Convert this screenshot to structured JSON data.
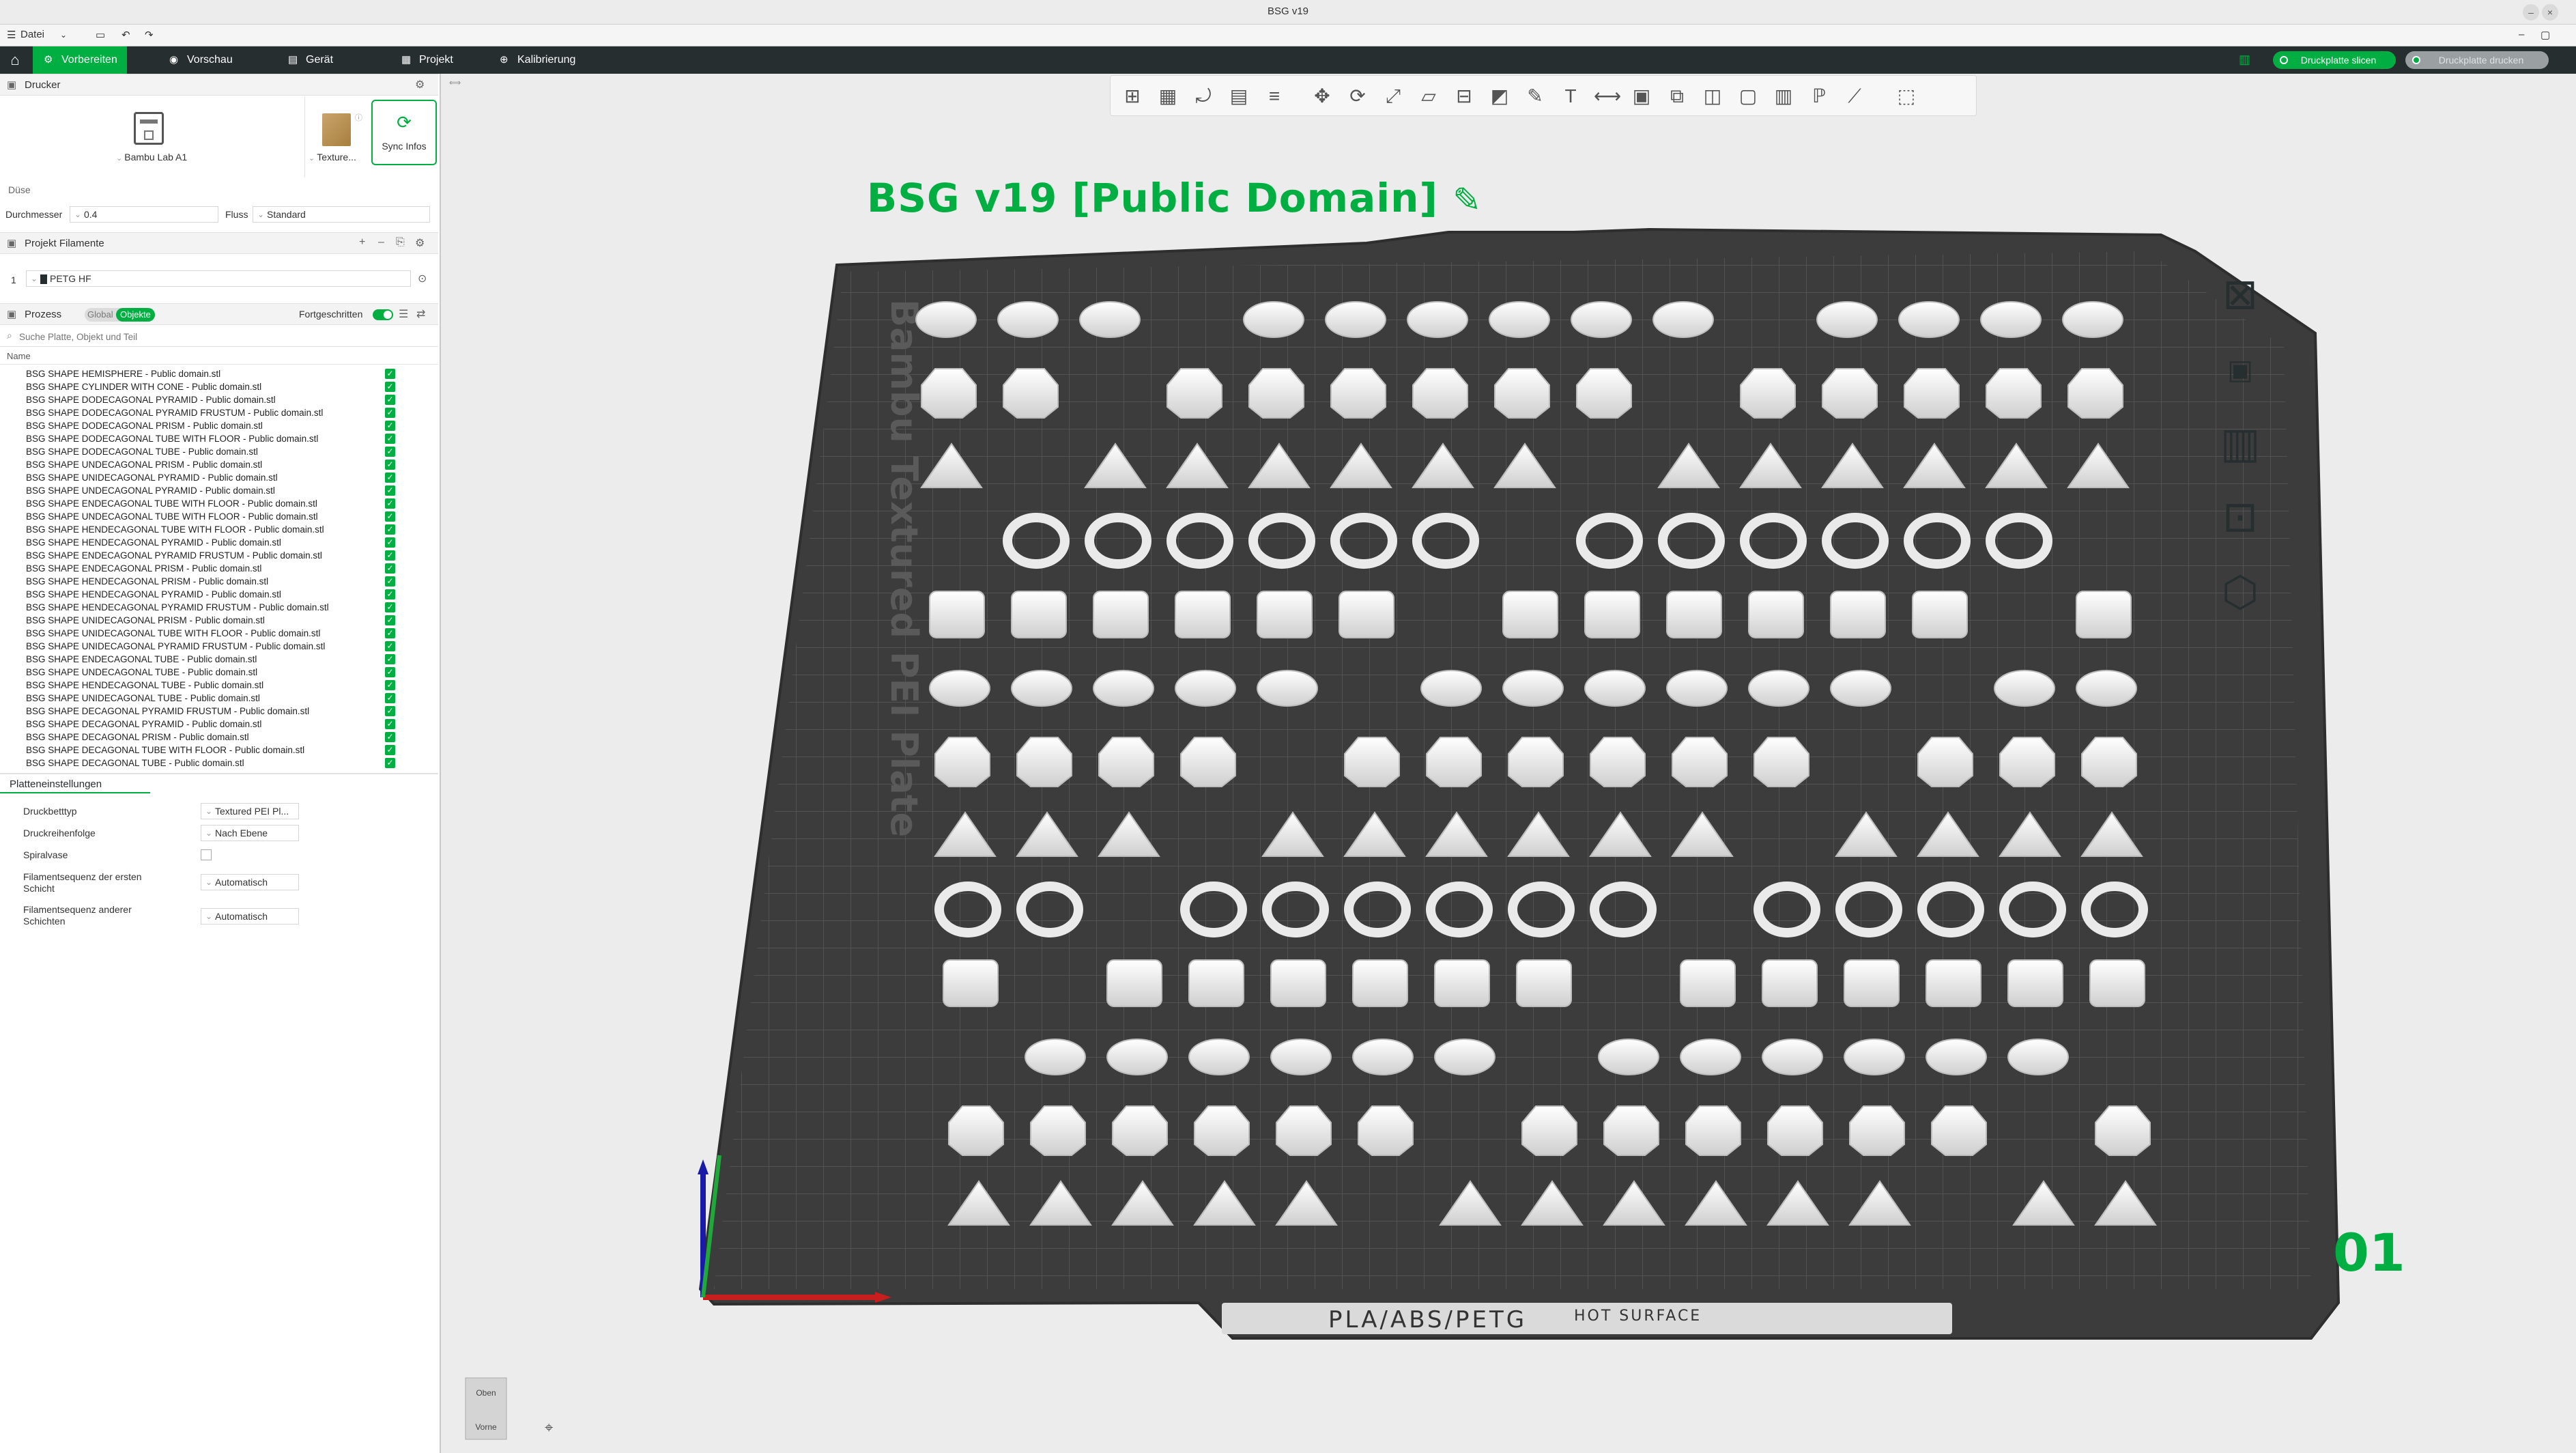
{
  "window": {
    "title": "BSG v19"
  },
  "menu": {
    "file": "Datei"
  },
  "tabs": [
    {
      "label": "Vorbereiten",
      "icon": "sliders-icon"
    },
    {
      "label": "Vorschau",
      "icon": "eye-icon"
    },
    {
      "label": "Gerät",
      "icon": "device-icon"
    },
    {
      "label": "Projekt",
      "icon": "project-icon"
    },
    {
      "label": "Kalibrierung",
      "icon": "calibration-icon"
    }
  ],
  "actions": {
    "slice": "Druckplatte slicen",
    "print": "Druckplatte drucken"
  },
  "printer": {
    "section": "Drucker",
    "name": "Bambu Lab A1",
    "plate": "Texture...",
    "sync": "Sync Infos"
  },
  "nozzle": {
    "section": "Düse",
    "diameter_label": "Durchmesser",
    "diameter": "0.4",
    "flow_label": "Fluss",
    "flow": "Standard"
  },
  "filaments": {
    "section": "Projekt Filamente",
    "items": [
      {
        "index": "1",
        "name": "PETG HF"
      }
    ]
  },
  "process": {
    "section": "Prozess",
    "global": "Global",
    "objects": "Objekte",
    "advanced": "Fortgeschritten",
    "search_placeholder": "Suche Platte, Objekt und Teil",
    "name_header": "Name"
  },
  "objects": [
    "BSG SHAPE HEMISPHERE - Public domain.stl",
    "BSG SHAPE CYLINDER WITH CONE - Public domain.stl",
    "BSG SHAPE DODECAGONAL PYRAMID - Public domain.stl",
    "BSG SHAPE DODECAGONAL PYRAMID FRUSTUM - Public domain.stl",
    "BSG SHAPE DODECAGONAL PRISM - Public domain.stl",
    "BSG SHAPE DODECAGONAL TUBE WITH FLOOR - Public domain.stl",
    "BSG SHAPE DODECAGONAL TUBE - Public domain.stl",
    "BSG SHAPE UNDECAGONAL PRISM - Public domain.stl",
    "BSG SHAPE UNIDECAGONAL PYRAMID - Public domain.stl",
    "BSG SHAPE UNDECAGONAL PYRAMID - Public domain.stl",
    "BSG SHAPE ENDECAGONAL TUBE WITH FLOOR - Public domain.stl",
    "BSG SHAPE UNDECAGONAL TUBE WITH FLOOR - Public domain.stl",
    "BSG SHAPE HENDECAGONAL TUBE WITH FLOOR - Public domain.stl",
    "BSG SHAPE HENDECAGONAL PYRAMID - Public domain.stl",
    "BSG SHAPE ENDECAGONAL PYRAMID FRUSTUM - Public domain.stl",
    "BSG SHAPE ENDECAGONAL PRISM - Public domain.stl",
    "BSG SHAPE HENDECAGONAL PRISM - Public domain.stl",
    "BSG SHAPE HENDECAGONAL PYRAMID - Public domain.stl",
    "BSG SHAPE HENDECAGONAL PYRAMID FRUSTUM - Public domain.stl",
    "BSG SHAPE UNIDECAGONAL PRISM - Public domain.stl",
    "BSG SHAPE UNIDECAGONAL TUBE WITH FLOOR - Public domain.stl",
    "BSG SHAPE UNIDECAGONAL PYRAMID FRUSTUM - Public domain.stl",
    "BSG SHAPE ENDECAGONAL TUBE - Public domain.stl",
    "BSG SHAPE UNDECAGONAL TUBE - Public domain.stl",
    "BSG SHAPE HENDECAGONAL TUBE - Public domain.stl",
    "BSG SHAPE UNIDECAGONAL TUBE - Public domain.stl",
    "BSG SHAPE DECAGONAL PYRAMID FRUSTUM - Public domain.stl",
    "BSG SHAPE DECAGONAL PYRAMID - Public domain.stl",
    "BSG SHAPE DECAGONAL PRISM - Public domain.stl",
    "BSG SHAPE DECAGONAL TUBE WITH FLOOR - Public domain.stl",
    "BSG SHAPE DECAGONAL TUBE - Public domain.stl"
  ],
  "plate_settings": {
    "section": "Platteneinstellungen",
    "rows": [
      {
        "label": "Druckbetttyp",
        "value": "Textured PEI Pl..."
      },
      {
        "label": "Druckreihenfolge",
        "value": "Nach Ebene"
      },
      {
        "label": "Spiralvase",
        "value": ""
      },
      {
        "label": "Filamentsequenz der ersten Schicht",
        "value": "Automatisch"
      },
      {
        "label": "Filamentsequenz anderer Schichten",
        "value": "Automatisch"
      }
    ]
  },
  "plate": {
    "title": "BSG v19    [Public Domain]",
    "number": "01",
    "bed_text": "Bambu Textured PEI Plate",
    "material_text": "PLA/ABS/PETG",
    "warning_text": "HOT SURFACE"
  },
  "view_cube": {
    "top": "Oben",
    "front": "Vorne"
  },
  "colors": {
    "accent": "#00ae42",
    "dark": "#262e30",
    "bed": "#3f3f3f"
  }
}
